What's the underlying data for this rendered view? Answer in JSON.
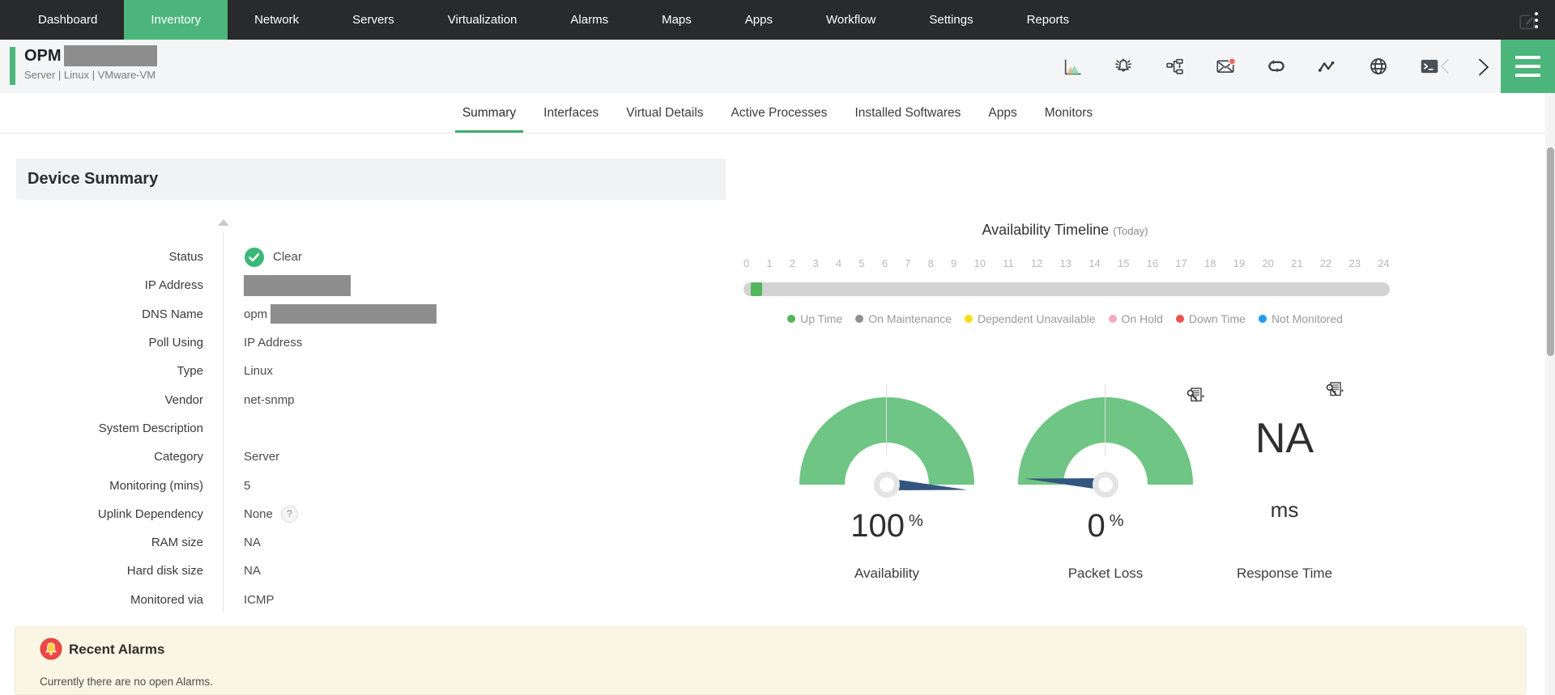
{
  "nav": {
    "items": [
      "Dashboard",
      "Inventory",
      "Network",
      "Servers",
      "Virtualization",
      "Alarms",
      "Maps",
      "Apps",
      "Workflow",
      "Settings",
      "Reports"
    ],
    "active": "Inventory"
  },
  "device_header": {
    "title": "OPM",
    "subtitle": "Server | Linux  | VMware-VM",
    "icons": [
      "area-chart",
      "alarm-bell",
      "workflow",
      "mail-unread",
      "loop",
      "pulse",
      "globe",
      "terminal",
      "chevron-left",
      "chevron-right",
      "menu"
    ]
  },
  "tabs": {
    "items": [
      "Summary",
      "Interfaces",
      "Virtual Details",
      "Active Processes",
      "Installed Softwares",
      "Apps",
      "Monitors"
    ],
    "active": "Summary"
  },
  "device_summary": {
    "title": "Device Summary",
    "fields": [
      {
        "label": "Status",
        "value": "Clear"
      },
      {
        "label": "IP Address",
        "value": ""
      },
      {
        "label": "DNS Name",
        "value": "opm"
      },
      {
        "label": "Poll Using",
        "value": "IP Address"
      },
      {
        "label": "Type",
        "value": "Linux"
      },
      {
        "label": "Vendor",
        "value": "net-snmp"
      },
      {
        "label": "System Description",
        "value": ""
      },
      {
        "label": "Category",
        "value": "Server"
      },
      {
        "label": "Monitoring (mins)",
        "value": "5"
      },
      {
        "label": "Uplink Dependency",
        "value": "None",
        "help_badge": "?"
      },
      {
        "label": "RAM size",
        "value": "NA"
      },
      {
        "label": "Hard disk size",
        "value": "NA"
      },
      {
        "label": "Monitored via",
        "value": "ICMP"
      }
    ]
  },
  "availability_timeline": {
    "title": "Availability Timeline",
    "subtitle": "(Today)",
    "hours": [
      "0",
      "1",
      "2",
      "3",
      "4",
      "5",
      "6",
      "7",
      "8",
      "9",
      "10",
      "11",
      "12",
      "13",
      "14",
      "15",
      "16",
      "17",
      "18",
      "19",
      "20",
      "21",
      "22",
      "23",
      "24"
    ],
    "uptime_segment": {
      "status": "Up Time",
      "approx_start_hour": 0.3,
      "approx_end_hour": 0.7
    },
    "legend": [
      {
        "label": "Up Time",
        "color": "#53b65c"
      },
      {
        "label": "On Maintenance",
        "color": "#8f8f8f"
      },
      {
        "label": "Dependent Unavailable",
        "color": "#f3df17"
      },
      {
        "label": "On Hold",
        "color": "#f5a9bc"
      },
      {
        "label": "Down Time",
        "color": "#ef5350"
      },
      {
        "label": "Not Monitored",
        "color": "#1e9df2"
      }
    ]
  },
  "gauges": {
    "arc_color": "#6fc583",
    "needle_color": "#34557f",
    "availability": {
      "value": "100",
      "unit": "%",
      "label": "Availability"
    },
    "packet_loss": {
      "value": "0",
      "unit": "%",
      "label": "Packet Loss"
    },
    "response_time": {
      "value": "NA",
      "unit": "ms",
      "label": "Response Time"
    }
  },
  "recent_alarms": {
    "title": "Recent Alarms",
    "message": "Currently there are no open Alarms."
  },
  "colors": {
    "accent_green": "#4cb57c",
    "nav_bg": "#282a2b",
    "status_clear": "#3bb877",
    "alarm_panel_bg": "#fbf6e3",
    "timeline_track": "#d3d3d3"
  }
}
